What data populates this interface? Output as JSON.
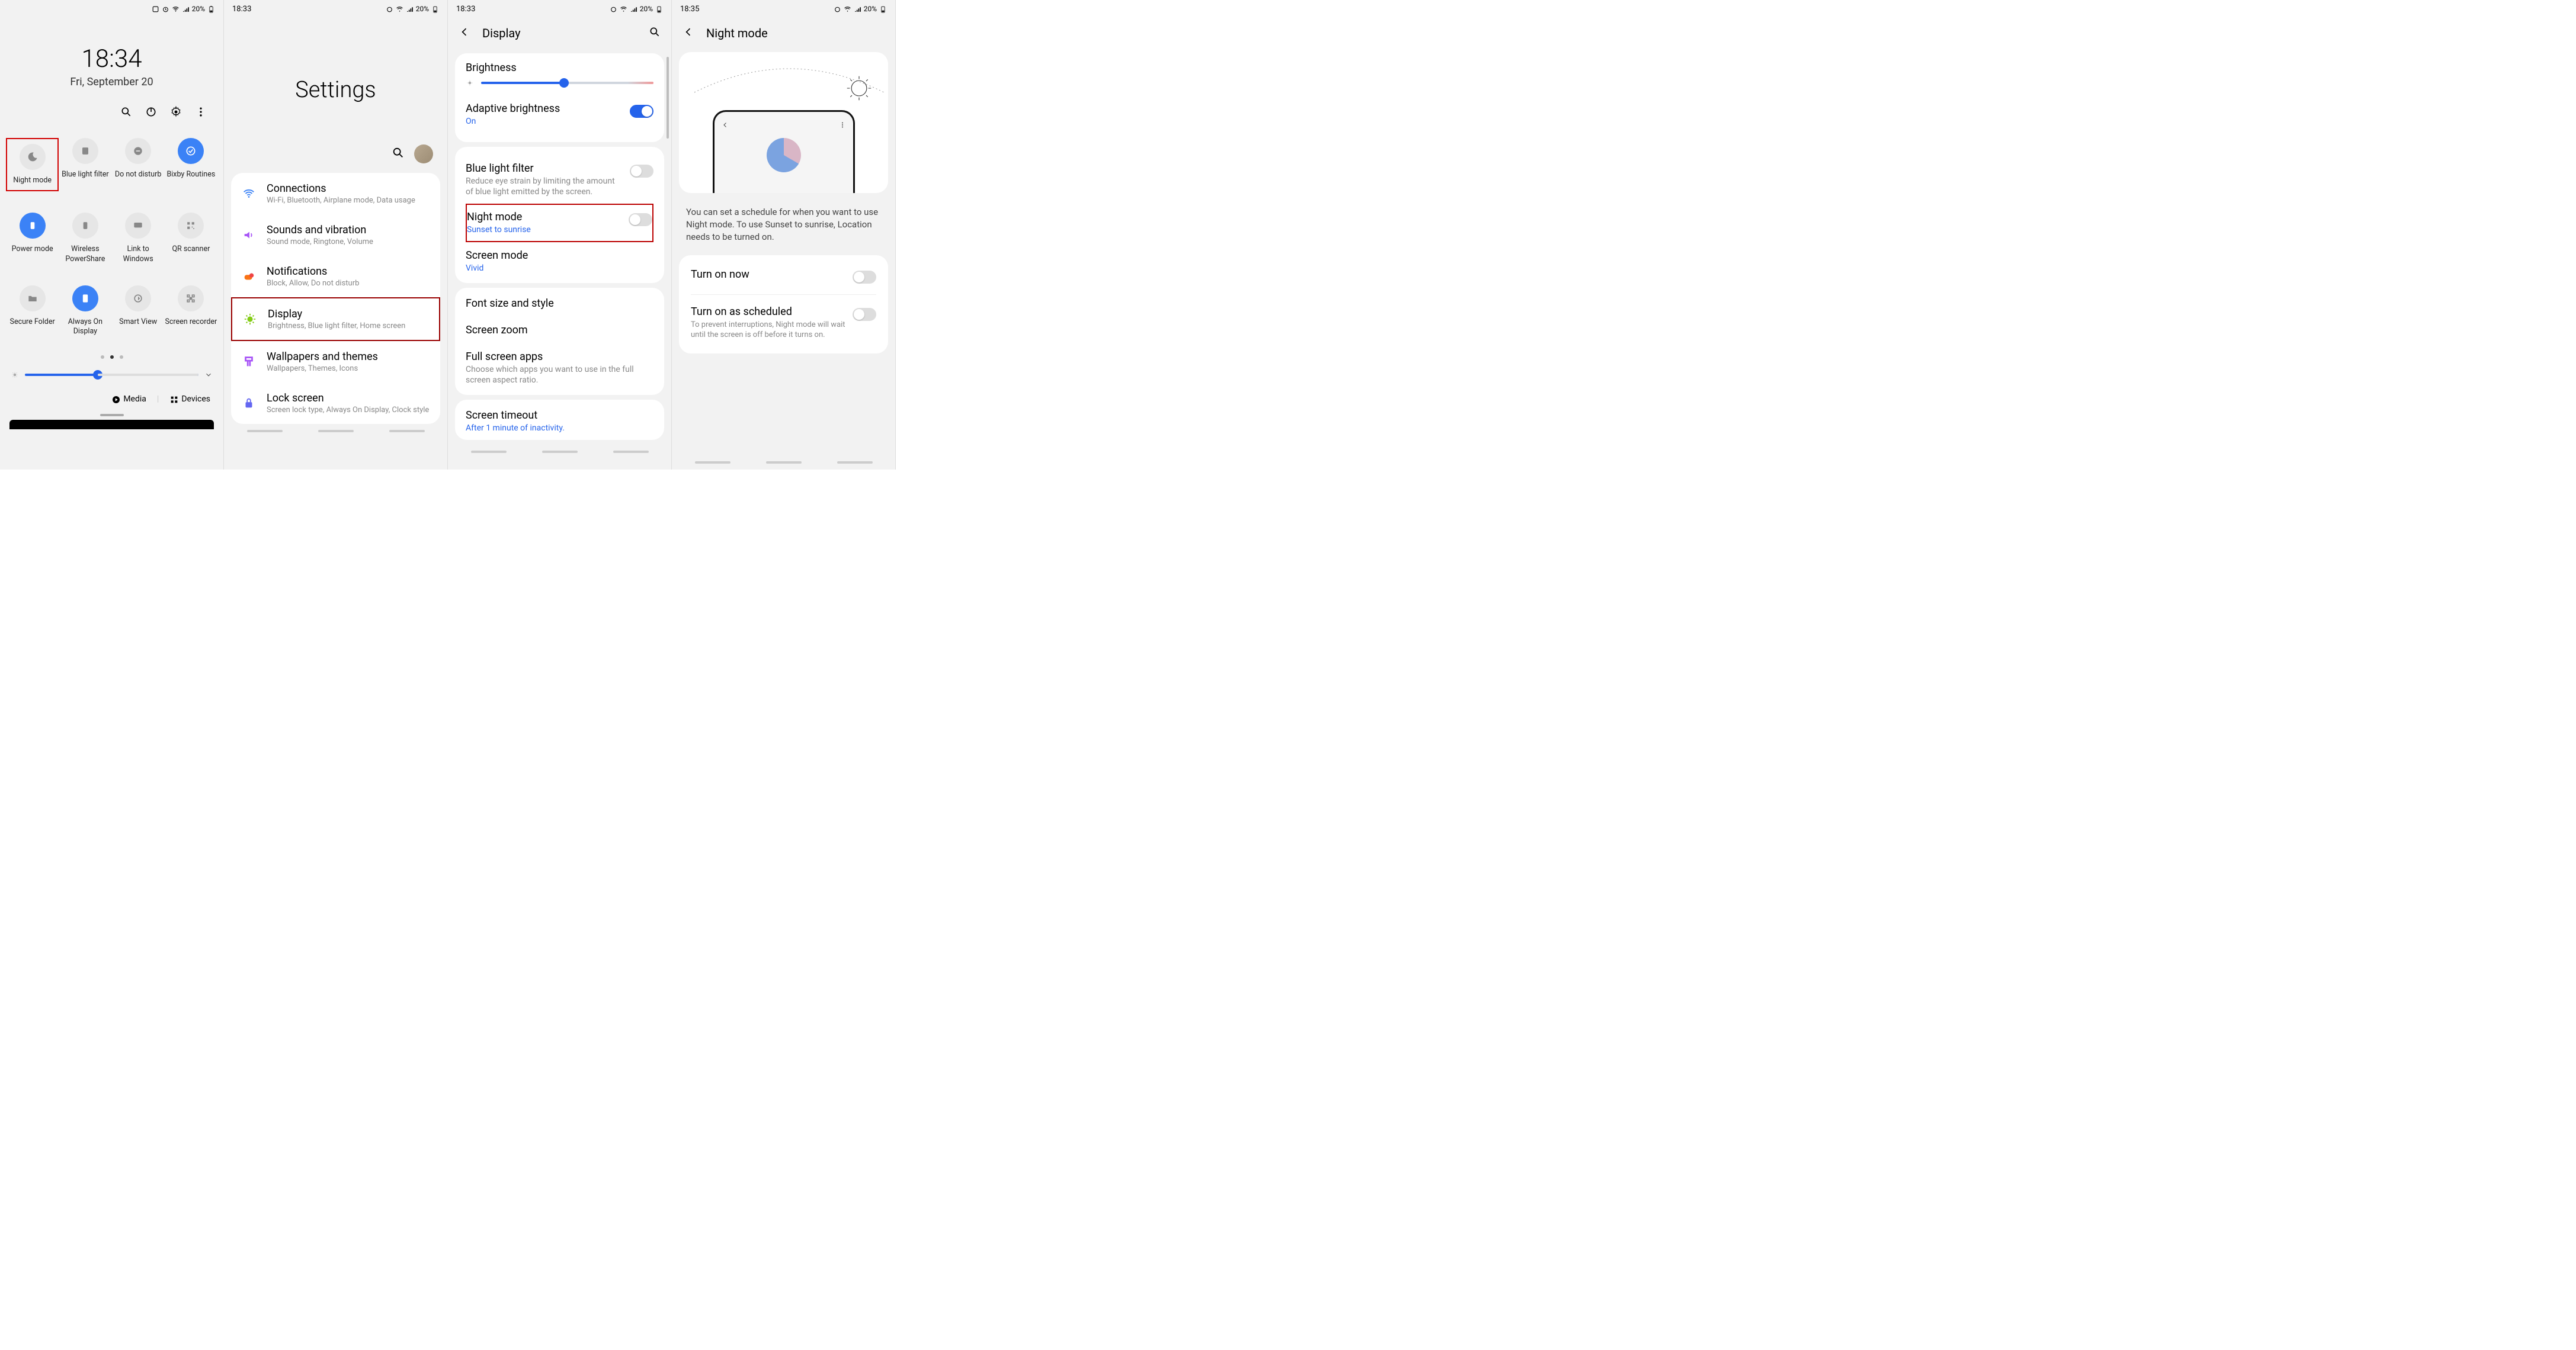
{
  "status": {
    "time1": "18:33",
    "time2": "18:33",
    "time3": "18:35",
    "battery_pct": "20%"
  },
  "screen1": {
    "clock": "18:34",
    "date": "Fri, September 20",
    "tiles": [
      {
        "label": "Night mode"
      },
      {
        "label": "Blue light filter"
      },
      {
        "label": "Do not disturb"
      },
      {
        "label": "Bixby Routines"
      },
      {
        "label": "Power mode"
      },
      {
        "label": "Wireless PowerShare"
      },
      {
        "label": "Link to Windows"
      },
      {
        "label": "QR scanner"
      },
      {
        "label": "Secure Folder"
      },
      {
        "label": "Always On Display"
      },
      {
        "label": "Smart View"
      },
      {
        "label": "Screen recorder"
      }
    ],
    "media": "Media",
    "devices": "Devices"
  },
  "screen2": {
    "title": "Settings",
    "items": [
      {
        "title": "Connections",
        "sub": "Wi-Fi, Bluetooth, Airplane mode, Data usage"
      },
      {
        "title": "Sounds and vibration",
        "sub": "Sound mode, Ringtone, Volume"
      },
      {
        "title": "Notifications",
        "sub": "Block, Allow, Do not disturb"
      },
      {
        "title": "Display",
        "sub": "Brightness, Blue light filter, Home screen"
      },
      {
        "title": "Wallpapers and themes",
        "sub": "Wallpapers, Themes, Icons"
      },
      {
        "title": "Lock screen",
        "sub": "Screen lock type, Always On Display, Clock style"
      }
    ]
  },
  "screen3": {
    "header": "Display",
    "brightness_label": "Brightness",
    "adaptive": {
      "title": "Adaptive brightness",
      "sub": "On"
    },
    "bluelight": {
      "title": "Blue light filter",
      "sub": "Reduce eye strain by limiting the amount of blue light emitted by the screen."
    },
    "nightmode": {
      "title": "Night mode",
      "sub": "Sunset to sunrise"
    },
    "screenmode": {
      "title": "Screen mode",
      "sub": "Vivid"
    },
    "font": "Font size and style",
    "zoom": "Screen zoom",
    "fullscreen": {
      "title": "Full screen apps",
      "sub": "Choose which apps you want to use in the full screen aspect ratio."
    },
    "timeout": {
      "title": "Screen timeout",
      "sub": "After 1 minute of inactivity."
    }
  },
  "screen4": {
    "header": "Night mode",
    "desc": "You can set a schedule for when you want to use Night mode. To use Sunset to sunrise, Location needs to be turned on.",
    "row1": "Turn on now",
    "row2": {
      "title": "Turn on as scheduled",
      "sub": "To prevent interruptions, Night mode will wait until the screen is off before it turns on."
    }
  }
}
